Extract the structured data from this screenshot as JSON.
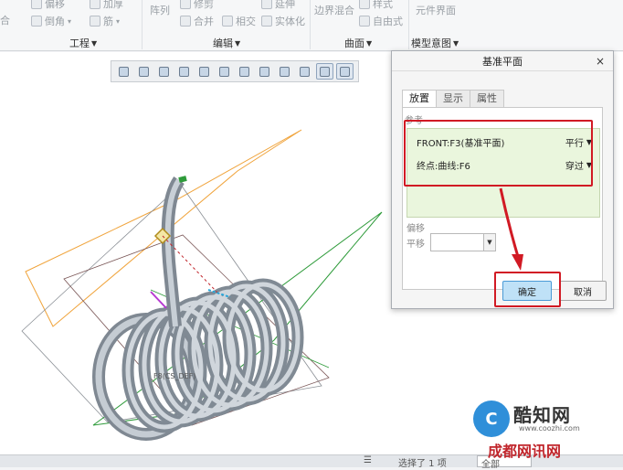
{
  "ribbon": {
    "top_items": [
      {
        "label": "合",
        "icon": "merge-icon"
      },
      {
        "label": "偏移",
        "icon": "offset-icon"
      },
      {
        "label": "加厚",
        "icon": "thicken-icon"
      },
      {
        "label": "阵列",
        "icon": "pattern-icon"
      },
      {
        "label": "修剪",
        "icon": "trim-icon"
      },
      {
        "label": "延伸",
        "icon": "extend-icon"
      },
      {
        "label": "边界混合",
        "icon": "boundary-blend-icon"
      },
      {
        "label": "样式",
        "icon": "style-icon"
      },
      {
        "label": "元件界面",
        "icon": "component-interface-icon"
      }
    ],
    "row2_items": [
      {
        "label": "倒角",
        "icon": "chamfer-icon"
      },
      {
        "label": "筋",
        "icon": "rib-icon"
      },
      {
        "label": "合并",
        "icon": "merge-icon"
      },
      {
        "label": "相交",
        "icon": "intersect-icon"
      },
      {
        "label": "实体化",
        "icon": "solidify-icon"
      },
      {
        "label": "自由式",
        "icon": "freestyle-icon"
      }
    ],
    "groups": [
      {
        "label": "工程"
      },
      {
        "label": "编辑"
      },
      {
        "label": "曲面"
      },
      {
        "label": "模型意图"
      }
    ]
  },
  "view_toolbar": {
    "buttons": [
      "zoom-fit-icon",
      "zoom-in-icon",
      "zoom-out-icon",
      "repaint-icon",
      "reorient-icon",
      "display-style-icon",
      "saved-views-icon",
      "named-views-icon",
      "annotation-display-icon",
      "datum-display-icon",
      "spin-center-icon",
      "datum-planes-icon"
    ]
  },
  "viewport": {
    "datum_label": "DTM1",
    "coil_label": "F8(CS_DEF)"
  },
  "dialog": {
    "title": "基准平面",
    "close": "×",
    "tabs": [
      {
        "label": "放置"
      },
      {
        "label": "显示"
      },
      {
        "label": "属性"
      }
    ],
    "references_label": "参考",
    "references": [
      {
        "name": "FRONT:F3(基准平面)",
        "mode": "平行"
      },
      {
        "name": "终点:曲线:F6",
        "mode": "穿过"
      }
    ],
    "offset_label": "偏移",
    "translate_label": "平移",
    "translate_value": "",
    "ok_label": "确定",
    "cancel_label": "取消"
  },
  "status": {
    "text": "选择了 1 项",
    "filter": "全部"
  },
  "watermark": {
    "logo": "C",
    "name": "酷知网",
    "url": "www.coozhi.com",
    "site": "成都网讯网"
  },
  "colors": {
    "highlight": "#d11a24",
    "coil": "#9aa3ad",
    "datum_orange": "#f0a33a",
    "datum_green": "#2e9b3a",
    "datum_dark": "#7a5656",
    "ok_button": "#bfe1f7"
  }
}
